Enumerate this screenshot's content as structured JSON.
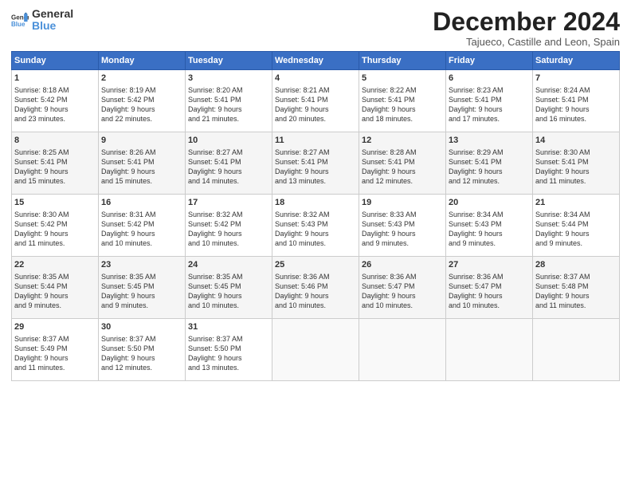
{
  "header": {
    "logo_general": "General",
    "logo_blue": "Blue",
    "month_title": "December 2024",
    "subtitle": "Tajueco, Castille and Leon, Spain"
  },
  "weekdays": [
    "Sunday",
    "Monday",
    "Tuesday",
    "Wednesday",
    "Thursday",
    "Friday",
    "Saturday"
  ],
  "weeks": [
    [
      {
        "day": "1",
        "lines": [
          "Sunrise: 8:18 AM",
          "Sunset: 5:42 PM",
          "Daylight: 9 hours",
          "and 23 minutes."
        ]
      },
      {
        "day": "2",
        "lines": [
          "Sunrise: 8:19 AM",
          "Sunset: 5:42 PM",
          "Daylight: 9 hours",
          "and 22 minutes."
        ]
      },
      {
        "day": "3",
        "lines": [
          "Sunrise: 8:20 AM",
          "Sunset: 5:41 PM",
          "Daylight: 9 hours",
          "and 21 minutes."
        ]
      },
      {
        "day": "4",
        "lines": [
          "Sunrise: 8:21 AM",
          "Sunset: 5:41 PM",
          "Daylight: 9 hours",
          "and 20 minutes."
        ]
      },
      {
        "day": "5",
        "lines": [
          "Sunrise: 8:22 AM",
          "Sunset: 5:41 PM",
          "Daylight: 9 hours",
          "and 18 minutes."
        ]
      },
      {
        "day": "6",
        "lines": [
          "Sunrise: 8:23 AM",
          "Sunset: 5:41 PM",
          "Daylight: 9 hours",
          "and 17 minutes."
        ]
      },
      {
        "day": "7",
        "lines": [
          "Sunrise: 8:24 AM",
          "Sunset: 5:41 PM",
          "Daylight: 9 hours",
          "and 16 minutes."
        ]
      }
    ],
    [
      {
        "day": "8",
        "lines": [
          "Sunrise: 8:25 AM",
          "Sunset: 5:41 PM",
          "Daylight: 9 hours",
          "and 15 minutes."
        ]
      },
      {
        "day": "9",
        "lines": [
          "Sunrise: 8:26 AM",
          "Sunset: 5:41 PM",
          "Daylight: 9 hours",
          "and 15 minutes."
        ]
      },
      {
        "day": "10",
        "lines": [
          "Sunrise: 8:27 AM",
          "Sunset: 5:41 PM",
          "Daylight: 9 hours",
          "and 14 minutes."
        ]
      },
      {
        "day": "11",
        "lines": [
          "Sunrise: 8:27 AM",
          "Sunset: 5:41 PM",
          "Daylight: 9 hours",
          "and 13 minutes."
        ]
      },
      {
        "day": "12",
        "lines": [
          "Sunrise: 8:28 AM",
          "Sunset: 5:41 PM",
          "Daylight: 9 hours",
          "and 12 minutes."
        ]
      },
      {
        "day": "13",
        "lines": [
          "Sunrise: 8:29 AM",
          "Sunset: 5:41 PM",
          "Daylight: 9 hours",
          "and 12 minutes."
        ]
      },
      {
        "day": "14",
        "lines": [
          "Sunrise: 8:30 AM",
          "Sunset: 5:41 PM",
          "Daylight: 9 hours",
          "and 11 minutes."
        ]
      }
    ],
    [
      {
        "day": "15",
        "lines": [
          "Sunrise: 8:30 AM",
          "Sunset: 5:42 PM",
          "Daylight: 9 hours",
          "and 11 minutes."
        ]
      },
      {
        "day": "16",
        "lines": [
          "Sunrise: 8:31 AM",
          "Sunset: 5:42 PM",
          "Daylight: 9 hours",
          "and 10 minutes."
        ]
      },
      {
        "day": "17",
        "lines": [
          "Sunrise: 8:32 AM",
          "Sunset: 5:42 PM",
          "Daylight: 9 hours",
          "and 10 minutes."
        ]
      },
      {
        "day": "18",
        "lines": [
          "Sunrise: 8:32 AM",
          "Sunset: 5:43 PM",
          "Daylight: 9 hours",
          "and 10 minutes."
        ]
      },
      {
        "day": "19",
        "lines": [
          "Sunrise: 8:33 AM",
          "Sunset: 5:43 PM",
          "Daylight: 9 hours",
          "and 9 minutes."
        ]
      },
      {
        "day": "20",
        "lines": [
          "Sunrise: 8:34 AM",
          "Sunset: 5:43 PM",
          "Daylight: 9 hours",
          "and 9 minutes."
        ]
      },
      {
        "day": "21",
        "lines": [
          "Sunrise: 8:34 AM",
          "Sunset: 5:44 PM",
          "Daylight: 9 hours",
          "and 9 minutes."
        ]
      }
    ],
    [
      {
        "day": "22",
        "lines": [
          "Sunrise: 8:35 AM",
          "Sunset: 5:44 PM",
          "Daylight: 9 hours",
          "and 9 minutes."
        ]
      },
      {
        "day": "23",
        "lines": [
          "Sunrise: 8:35 AM",
          "Sunset: 5:45 PM",
          "Daylight: 9 hours",
          "and 9 minutes."
        ]
      },
      {
        "day": "24",
        "lines": [
          "Sunrise: 8:35 AM",
          "Sunset: 5:45 PM",
          "Daylight: 9 hours",
          "and 10 minutes."
        ]
      },
      {
        "day": "25",
        "lines": [
          "Sunrise: 8:36 AM",
          "Sunset: 5:46 PM",
          "Daylight: 9 hours",
          "and 10 minutes."
        ]
      },
      {
        "day": "26",
        "lines": [
          "Sunrise: 8:36 AM",
          "Sunset: 5:47 PM",
          "Daylight: 9 hours",
          "and 10 minutes."
        ]
      },
      {
        "day": "27",
        "lines": [
          "Sunrise: 8:36 AM",
          "Sunset: 5:47 PM",
          "Daylight: 9 hours",
          "and 10 minutes."
        ]
      },
      {
        "day": "28",
        "lines": [
          "Sunrise: 8:37 AM",
          "Sunset: 5:48 PM",
          "Daylight: 9 hours",
          "and 11 minutes."
        ]
      }
    ],
    [
      {
        "day": "29",
        "lines": [
          "Sunrise: 8:37 AM",
          "Sunset: 5:49 PM",
          "Daylight: 9 hours",
          "and 11 minutes."
        ]
      },
      {
        "day": "30",
        "lines": [
          "Sunrise: 8:37 AM",
          "Sunset: 5:50 PM",
          "Daylight: 9 hours",
          "and 12 minutes."
        ]
      },
      {
        "day": "31",
        "lines": [
          "Sunrise: 8:37 AM",
          "Sunset: 5:50 PM",
          "Daylight: 9 hours",
          "and 13 minutes."
        ]
      },
      null,
      null,
      null,
      null
    ]
  ]
}
